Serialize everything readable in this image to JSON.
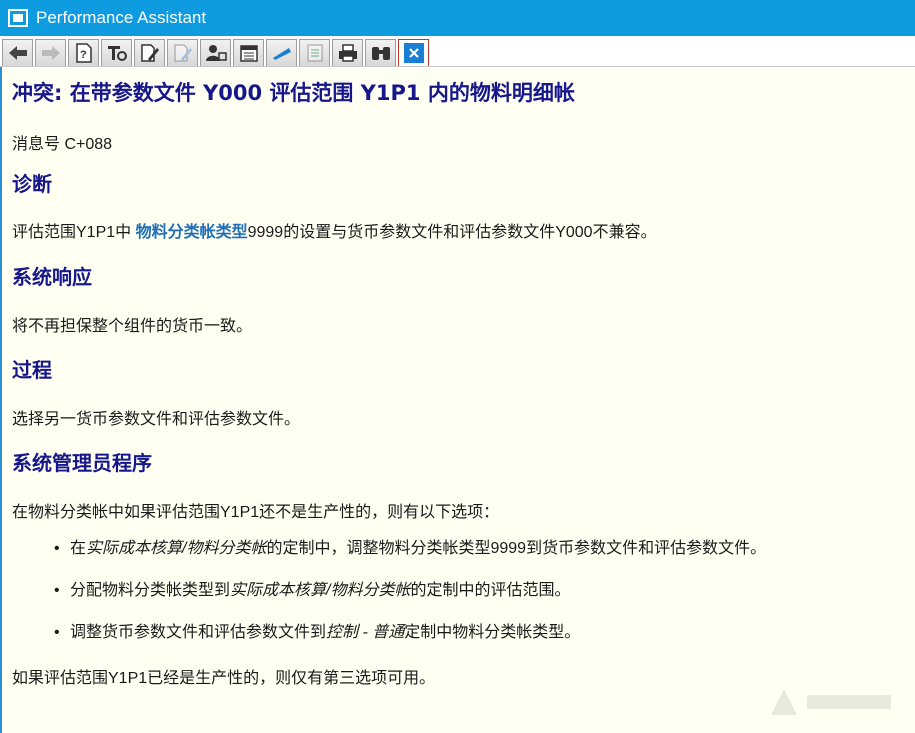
{
  "window": {
    "title": "Performance Assistant"
  },
  "toolbar": {
    "buttons": [
      {
        "icon": "back-arrow-icon",
        "enabled": true
      },
      {
        "icon": "forward-arrow-icon",
        "enabled": false
      },
      {
        "icon": "document-help-icon",
        "enabled": true
      },
      {
        "icon": "technical-info-icon",
        "enabled": true
      },
      {
        "icon": "edit-document-icon",
        "enabled": true
      },
      {
        "icon": "pen-document-icon",
        "enabled": false
      },
      {
        "icon": "user-settings-icon",
        "enabled": true
      },
      {
        "icon": "calendar-icon",
        "enabled": true
      },
      {
        "icon": "bookmark-icon",
        "enabled": true
      },
      {
        "icon": "document-list-icon",
        "enabled": false
      },
      {
        "icon": "print-icon",
        "enabled": true
      },
      {
        "icon": "binoculars-icon",
        "enabled": true
      },
      {
        "icon": "close-icon",
        "enabled": true
      }
    ]
  },
  "doc": {
    "title": "冲突: 在带参数文件  Y000 评估范围 Y1P1 内的物料明细帐",
    "message_no": "消息号 C+088",
    "diagnosis": {
      "heading": "诊断",
      "text_before": "评估范围Y1P1中 ",
      "link": "物料分类帐类型",
      "text_after": "9999的设置与货币参数文件和评估参数文件Y000不兼容。"
    },
    "system_response": {
      "heading": "系统响应",
      "text": "将不再担保整个组件的货币一致。"
    },
    "procedure": {
      "heading": "过程",
      "text": "选择另一货币参数文件和评估参数文件。"
    },
    "admin": {
      "heading": "系统管理员程序",
      "intro": "在物料分类帐中如果评估范围Y1P1还不是生产性的，则有以下选项：",
      "items": [
        {
          "pre": "在",
          "italic": "实际成本核算/物料分类帐",
          "post": "的定制中，调整物料分类帐类型9999到货币参数文件和评估参数文件。"
        },
        {
          "pre": "分配物料分类帐类型到",
          "italic": "实际成本核算/物料分类帐",
          "post": "的定制中的评估范围。"
        },
        {
          "pre": "调整货币参数文件和评估参数文件到",
          "italic": "控制 - 普通",
          "post": "定制中物料分类帐类型。"
        }
      ],
      "outro": "如果评估范围Y1P1已经是生产性的，则仅有第三选项可用。"
    }
  },
  "colors": {
    "titlebar": "#0f9be0",
    "heading": "#17178c",
    "link": "#1f6fb8",
    "background": "#fffff2"
  }
}
